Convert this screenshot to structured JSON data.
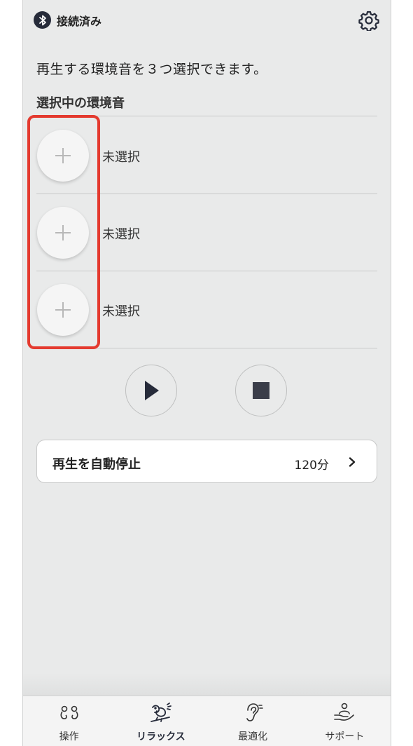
{
  "status": {
    "connection": "接続済み",
    "bluetooth_icon": "bluetooth-icon",
    "settings_icon": "gear-icon"
  },
  "intro": "再生する環境音を３つ選択できます。",
  "section_title": "選択中の環境音",
  "slots": [
    {
      "label": "未選択",
      "icon": "plus-icon"
    },
    {
      "label": "未選択",
      "icon": "plus-icon"
    },
    {
      "label": "未選択",
      "icon": "plus-icon"
    }
  ],
  "controls": {
    "play_icon": "play-icon",
    "stop_icon": "stop-icon"
  },
  "autostop": {
    "label": "再生を自動停止",
    "value": "120分"
  },
  "tabs": [
    {
      "label": "操作",
      "icon": "earbuds-icon",
      "active": false
    },
    {
      "label": "リラックス",
      "icon": "bird-icon",
      "active": true
    },
    {
      "label": "最適化",
      "icon": "ear-icon",
      "active": false
    },
    {
      "label": "サポート",
      "icon": "support-icon",
      "active": false
    }
  ],
  "colors": {
    "accent": "#262b3a",
    "highlight": "#e43a2f",
    "background": "#e9eaea"
  }
}
